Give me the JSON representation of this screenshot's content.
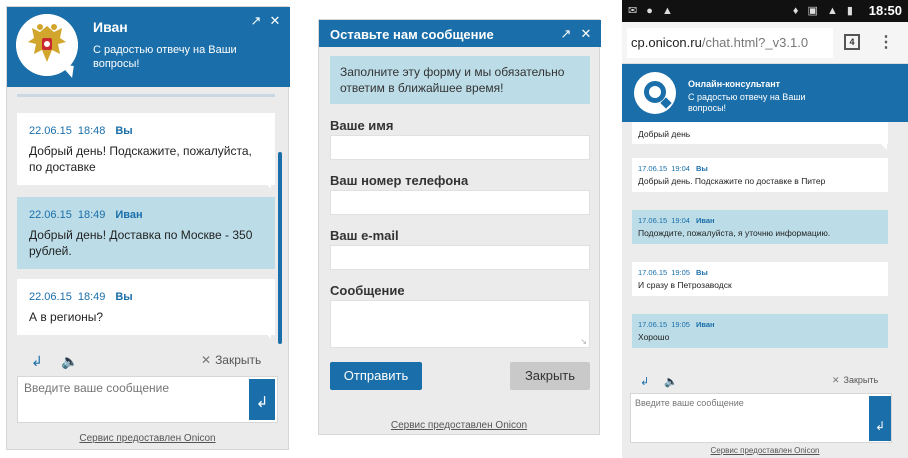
{
  "chat_widget": {
    "operator_name": "Иван",
    "operator_subtitle": "С радостью отвечу на Ваши вопросы!",
    "messages": [
      {
        "date": "22.06.15",
        "time": "18:48",
        "author": "Вы",
        "text": "Добрый день! Подскажите, пожалуйста, по доставке",
        "from_operator": false
      },
      {
        "date": "22.06.15",
        "time": "18:49",
        "author": "Иван",
        "text": "Добрый день! Доставка по Москве - 350 рублей.",
        "from_operator": true
      },
      {
        "date": "22.06.15",
        "time": "18:49",
        "author": "Вы",
        "text": "А в регионы?",
        "from_operator": false
      }
    ],
    "close_label": "Закрыть",
    "input_placeholder": "Введите ваше сообщение",
    "footer": "Сервис предоставлен Onicon",
    "icons": {
      "expand": "expand-icon",
      "close": "close-icon",
      "reply": "reply-icon",
      "sound": "speaker-icon",
      "send": "enter-icon"
    }
  },
  "form_widget": {
    "title": "Оставьте нам сообщение",
    "notice": "Заполните эту форму и мы обязательно ответим в ближайшее время!",
    "fields": {
      "name_label": "Ваше имя",
      "phone_label": "Ваш номер телефона",
      "email_label": "Ваш e-mail",
      "message_label": "Сообщение"
    },
    "send_button": "Отправить",
    "close_button": "Закрыть",
    "footer": "Сервис предоставлен Onicon"
  },
  "mobile": {
    "status_time": "18:50",
    "url_host": "cp.onicon.ru",
    "url_rest": "/chat.html?_v3.1.0",
    "tab_count": "4",
    "header_title": "Онлайн-консультант",
    "header_subtitle": "С радостью отвечу на Ваши вопросы!",
    "messages": [
      {
        "date": "",
        "time": "",
        "author": "",
        "text": "Добрый день",
        "from_operator": false,
        "partial": true
      },
      {
        "date": "17.06.15",
        "time": "19:04",
        "author": "Вы",
        "text": "Добрый день. Подскажите по доставке в Питер",
        "from_operator": false
      },
      {
        "date": "17.06.15",
        "time": "19:04",
        "author": "Иван",
        "text": "Подождите, пожалуйста, я уточню информацию.",
        "from_operator": true
      },
      {
        "date": "17.06.15",
        "time": "19:05",
        "author": "Вы",
        "text": "И сразу в Петрозаводск",
        "from_operator": false
      },
      {
        "date": "17.06.15",
        "time": "19:05",
        "author": "Иван",
        "text": "Хорошо",
        "from_operator": true
      }
    ],
    "close_label": "Закрыть",
    "input_placeholder": "Введите ваше сообщение",
    "footer": "Сервис предоставлен Onicon"
  },
  "colors": {
    "brand_blue": "#1a6ea9",
    "operator_bubble": "#bcdde8",
    "panel_bg": "#ebebeb"
  }
}
